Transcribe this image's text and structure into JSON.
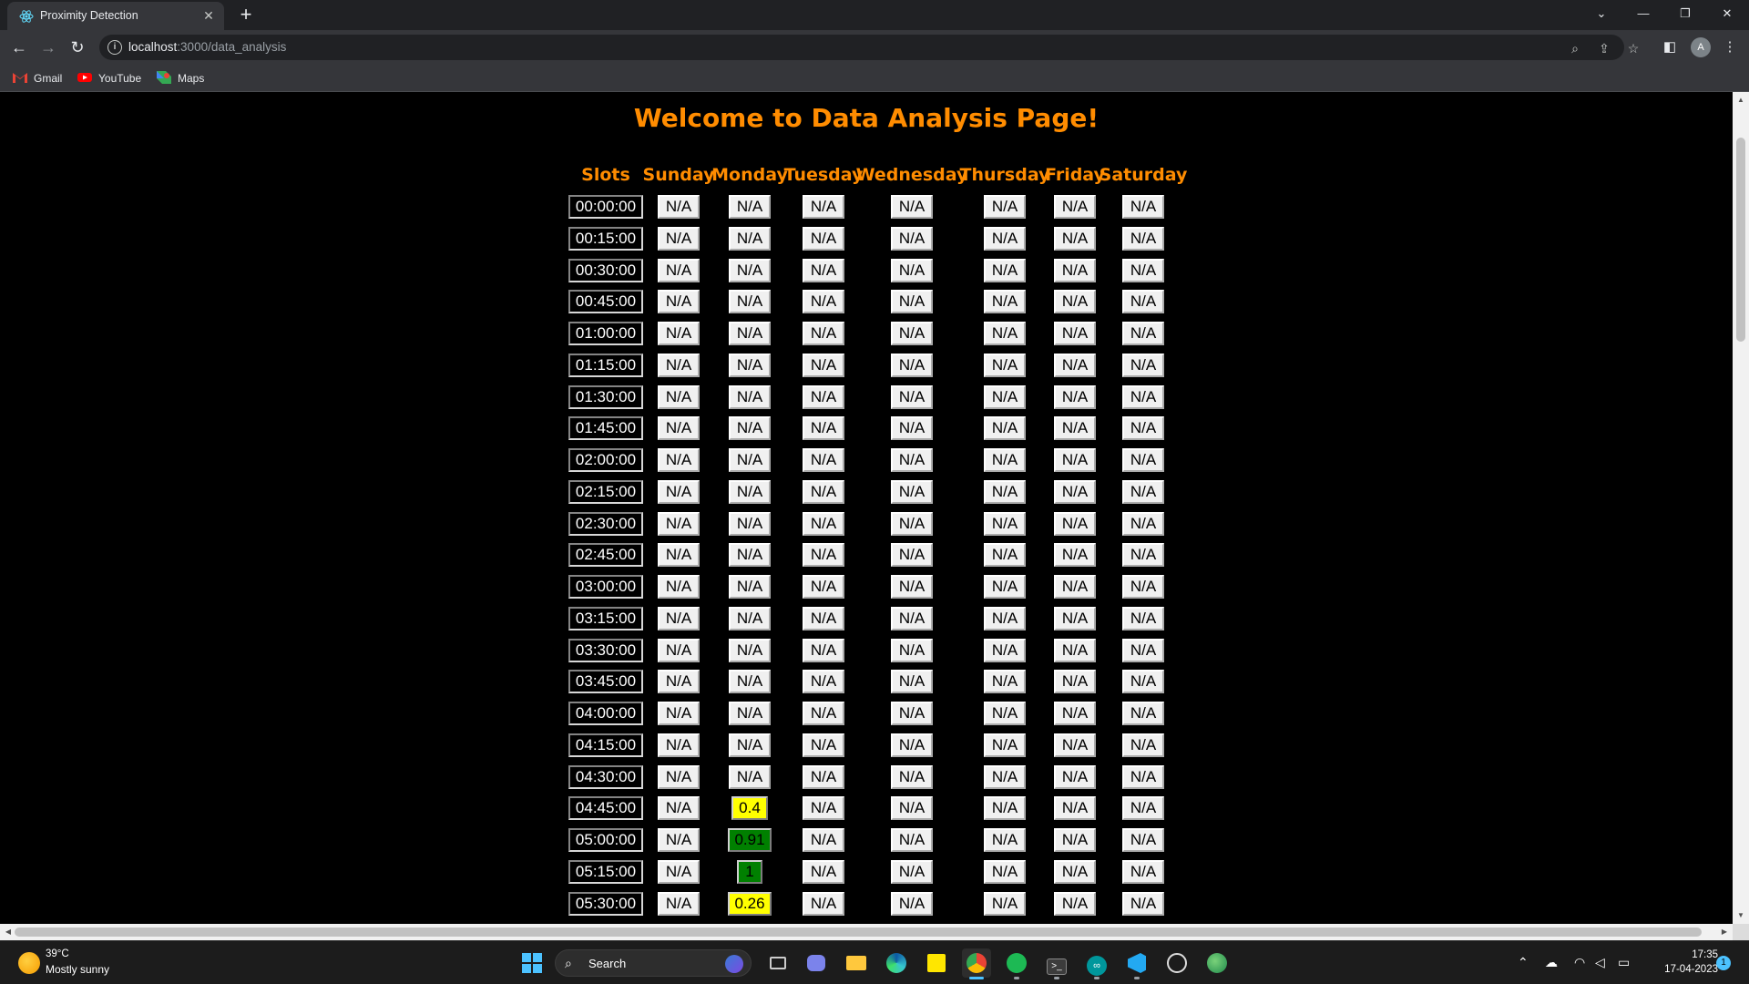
{
  "browser": {
    "tab_title": "Proximity Detection",
    "url_host": "localhost",
    "url_path": ":3000/data_analysis",
    "bookmarks": [
      {
        "label": "Gmail",
        "icon": "gmail-icon"
      },
      {
        "label": "YouTube",
        "icon": "youtube-icon"
      },
      {
        "label": "Maps",
        "icon": "maps-icon"
      }
    ],
    "profile_initial": "A"
  },
  "page": {
    "title": "Welcome to Data Analysis Page!",
    "headers": [
      "Slots",
      "Sunday",
      "Monday",
      "Tuesday",
      "Wednesday",
      "Thursday",
      "Friday",
      "Saturday"
    ],
    "rows": [
      {
        "slot": "00:00:00",
        "values": [
          "N/A",
          "N/A",
          "N/A",
          "N/A",
          "N/A",
          "N/A",
          "N/A"
        ]
      },
      {
        "slot": "00:15:00",
        "values": [
          "N/A",
          "N/A",
          "N/A",
          "N/A",
          "N/A",
          "N/A",
          "N/A"
        ]
      },
      {
        "slot": "00:30:00",
        "values": [
          "N/A",
          "N/A",
          "N/A",
          "N/A",
          "N/A",
          "N/A",
          "N/A"
        ]
      },
      {
        "slot": "00:45:00",
        "values": [
          "N/A",
          "N/A",
          "N/A",
          "N/A",
          "N/A",
          "N/A",
          "N/A"
        ]
      },
      {
        "slot": "01:00:00",
        "values": [
          "N/A",
          "N/A",
          "N/A",
          "N/A",
          "N/A",
          "N/A",
          "N/A"
        ]
      },
      {
        "slot": "01:15:00",
        "values": [
          "N/A",
          "N/A",
          "N/A",
          "N/A",
          "N/A",
          "N/A",
          "N/A"
        ]
      },
      {
        "slot": "01:30:00",
        "values": [
          "N/A",
          "N/A",
          "N/A",
          "N/A",
          "N/A",
          "N/A",
          "N/A"
        ]
      },
      {
        "slot": "01:45:00",
        "values": [
          "N/A",
          "N/A",
          "N/A",
          "N/A",
          "N/A",
          "N/A",
          "N/A"
        ]
      },
      {
        "slot": "02:00:00",
        "values": [
          "N/A",
          "N/A",
          "N/A",
          "N/A",
          "N/A",
          "N/A",
          "N/A"
        ]
      },
      {
        "slot": "02:15:00",
        "values": [
          "N/A",
          "N/A",
          "N/A",
          "N/A",
          "N/A",
          "N/A",
          "N/A"
        ]
      },
      {
        "slot": "02:30:00",
        "values": [
          "N/A",
          "N/A",
          "N/A",
          "N/A",
          "N/A",
          "N/A",
          "N/A"
        ]
      },
      {
        "slot": "02:45:00",
        "values": [
          "N/A",
          "N/A",
          "N/A",
          "N/A",
          "N/A",
          "N/A",
          "N/A"
        ]
      },
      {
        "slot": "03:00:00",
        "values": [
          "N/A",
          "N/A",
          "N/A",
          "N/A",
          "N/A",
          "N/A",
          "N/A"
        ]
      },
      {
        "slot": "03:15:00",
        "values": [
          "N/A",
          "N/A",
          "N/A",
          "N/A",
          "N/A",
          "N/A",
          "N/A"
        ]
      },
      {
        "slot": "03:30:00",
        "values": [
          "N/A",
          "N/A",
          "N/A",
          "N/A",
          "N/A",
          "N/A",
          "N/A"
        ]
      },
      {
        "slot": "03:45:00",
        "values": [
          "N/A",
          "N/A",
          "N/A",
          "N/A",
          "N/A",
          "N/A",
          "N/A"
        ]
      },
      {
        "slot": "04:00:00",
        "values": [
          "N/A",
          "N/A",
          "N/A",
          "N/A",
          "N/A",
          "N/A",
          "N/A"
        ]
      },
      {
        "slot": "04:15:00",
        "values": [
          "N/A",
          "N/A",
          "N/A",
          "N/A",
          "N/A",
          "N/A",
          "N/A"
        ]
      },
      {
        "slot": "04:30:00",
        "values": [
          "N/A",
          "N/A",
          "N/A",
          "N/A",
          "N/A",
          "N/A",
          "N/A"
        ]
      },
      {
        "slot": "04:45:00",
        "values": [
          "N/A",
          "0.4",
          "N/A",
          "N/A",
          "N/A",
          "N/A",
          "N/A"
        ]
      },
      {
        "slot": "05:00:00",
        "values": [
          "N/A",
          "0.91",
          "N/A",
          "N/A",
          "N/A",
          "N/A",
          "N/A"
        ]
      },
      {
        "slot": "05:15:00",
        "values": [
          "N/A",
          "1",
          "N/A",
          "N/A",
          "N/A",
          "N/A",
          "N/A"
        ]
      },
      {
        "slot": "05:30:00",
        "values": [
          "N/A",
          "0.26",
          "N/A",
          "N/A",
          "N/A",
          "N/A",
          "N/A"
        ]
      }
    ],
    "colors": {
      "title": "#ff8c00",
      "low": "#ffff00",
      "high": "#008000"
    }
  },
  "taskbar": {
    "weather_temp": "39°C",
    "weather_cond": "Mostly sunny",
    "search_label": "Search",
    "time": "17:35",
    "date": "17-04-2023",
    "notification_count": "1",
    "apps": [
      "windows-start-icon",
      "task-view-icon",
      "teams-icon",
      "file-explorer-icon",
      "edge-icon",
      "sticky-notes-icon",
      "chrome-icon",
      "spotify-icon",
      "terminal-icon",
      "arduino-icon",
      "vscode-icon",
      "github-icon",
      "globe-icon"
    ]
  }
}
